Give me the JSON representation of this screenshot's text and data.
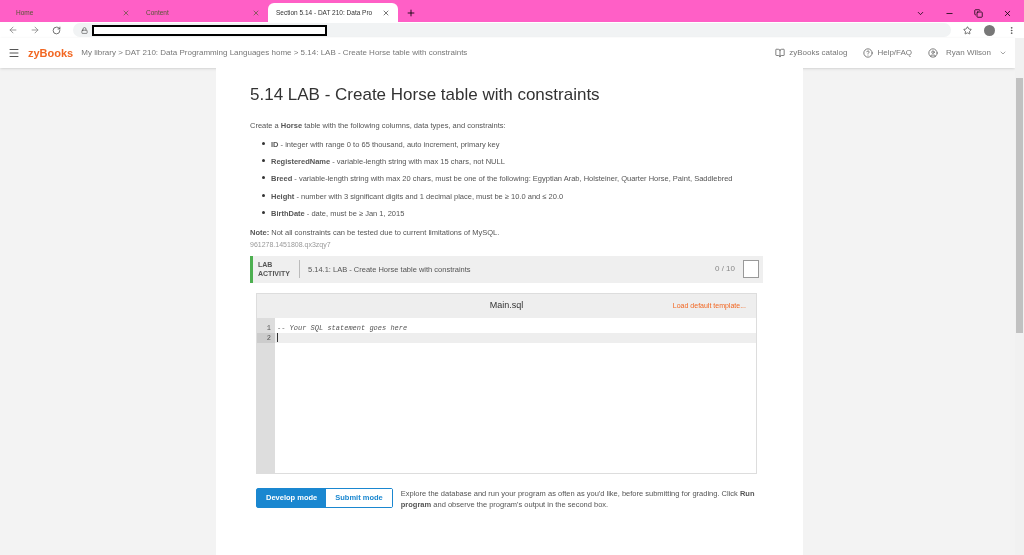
{
  "browser_tabs": [
    {
      "title": "Home",
      "selected": false
    },
    {
      "title": "Content",
      "selected": false
    },
    {
      "title": "Section 5.14 - DAT 210: Data Pro",
      "selected": true
    }
  ],
  "nav": {
    "logo": "zyBooks",
    "breadcrumb": "My library > DAT 210: Data Programming Languages home > 5.14: LAB - Create Horse table with constraints",
    "links": [
      "zyBooks catalog",
      "Help/FAQ"
    ],
    "user": "Ryan Wilson"
  },
  "section": {
    "title": "5.14 LAB - Create Horse table with constraints",
    "intro": "Create a **Horse** table with the following columns, data types, and constraints:",
    "bullets": [
      "**ID** - integer with range 0 to 65 thousand, auto increment, primary key",
      "**RegisteredName** - variable-length string with max 15 chars, not NULL",
      "**Breed** - variable-length string with max 20 chars, must be one of the following: Egyptian Arab, Holsteiner, Quarter Horse, Paint, Saddlebred",
      "**Height** - number with 3 significant digits and 1 decimal place, must be ≥ 10.0 and ≤ 20.0",
      "**BirthDate** - date, must be ≥ Jan 1, 2015"
    ],
    "note": "**Note:** Not all constraints can be tested due to current limitations of MySQL.",
    "id": "961278.1451808.qx3zqy7"
  },
  "activity": {
    "label": "LAB ACTIVITY",
    "title": "5.14.1: LAB - Create Horse table with constraints",
    "score": "0 / 10",
    "editor": {
      "filename": "Main.sql",
      "template_link": "Load default template...",
      "lines": [
        {
          "number": "1",
          "text": "-- Your SQL statement goes here"
        },
        {
          "number": "2"
        }
      ]
    },
    "modes": [
      {
        "label": "Develop mode",
        "selected": true
      },
      {
        "label": "Submit mode",
        "selected": false
      }
    ],
    "help": "Explore the database and run your program as often as you'd like, before submitting for grading. Click **Run program** and observe the program's output in the second box."
  }
}
